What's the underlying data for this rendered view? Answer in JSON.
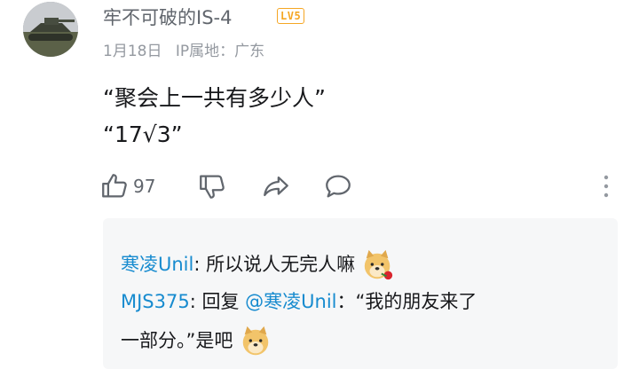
{
  "comment": {
    "username": "牢不可破的IS-4",
    "level": "LV5",
    "date": "1月18日",
    "ip_location": "IP属地：广东",
    "content": "“聚会上一共有多少人”\n“17√3”",
    "like_count": "97"
  },
  "replies": [
    {
      "user": "寒凌Unil",
      "colon": ":",
      "text": " 所以说人无完人嘛"
    },
    {
      "user": "MJS375",
      "colon": ":",
      "text": " 回复 ",
      "mention": "@寒凌Unil",
      "text2": "：“我的朋友来了",
      "cont": "一部分。”是吧"
    }
  ],
  "icons": {
    "like": "thumbs-up-icon",
    "dislike": "thumbs-down-icon",
    "share": "share-icon",
    "reply": "chat-bubble-icon",
    "more": "more-vertical-icon"
  },
  "colors": {
    "username_link": "#178bcf",
    "level_badge": "#f5a623",
    "meta_text": "#9499a0"
  }
}
